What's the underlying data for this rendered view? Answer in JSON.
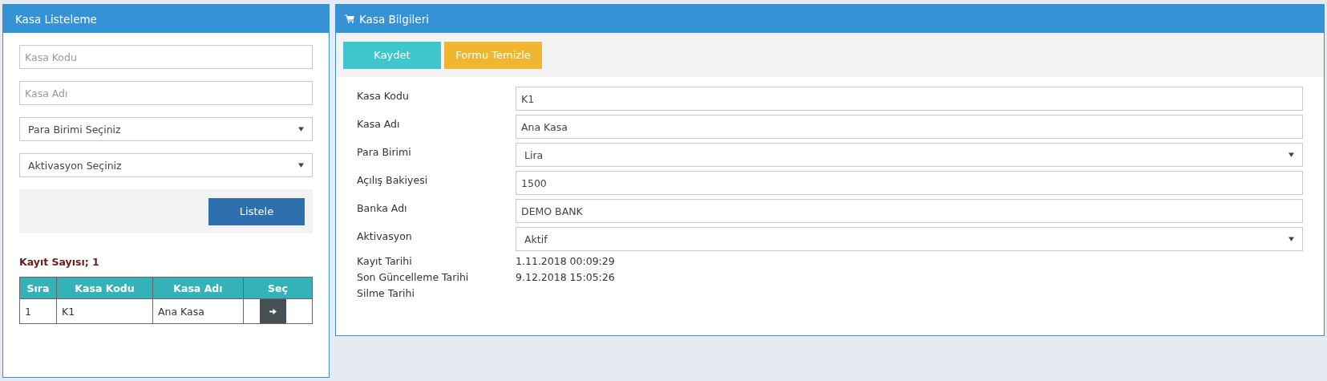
{
  "list_panel": {
    "title": "Kasa Listeleme",
    "filters": [
      {
        "kind": "text",
        "placeholder": "Kasa Kodu"
      },
      {
        "kind": "text",
        "placeholder": "Kasa Adı"
      },
      {
        "kind": "select",
        "value": "Para Birimi Seçiniz"
      },
      {
        "kind": "select",
        "value": "Aktivasyon Seçiniz"
      }
    ],
    "list_button": "Listele",
    "record_count": "Kayıt Sayısı; 1",
    "table": {
      "columns": [
        "Sıra",
        "Kasa Kodu",
        "Kasa Adı",
        "Seç"
      ],
      "rows": [
        {
          "cells": [
            "1",
            "K1",
            "Ana Kasa"
          ]
        }
      ]
    }
  },
  "detail_panel": {
    "title": "Kasa Bilgileri",
    "buttons": [
      {
        "kind": "save",
        "label": "Kaydet"
      },
      {
        "kind": "clear",
        "label": "Formu Temizle"
      }
    ],
    "fields": [
      {
        "kind": "text",
        "label": "Kasa Kodu",
        "value": "K1"
      },
      {
        "kind": "text",
        "label": "Kasa Adı",
        "value": "Ana Kasa"
      },
      {
        "kind": "select",
        "label": "Para Birimi",
        "value": "Lira"
      },
      {
        "kind": "text",
        "label": "Açılış Bakiyesi",
        "value": "1500"
      },
      {
        "kind": "text",
        "label": "Banka Adı",
        "value": "DEMO BANK"
      },
      {
        "kind": "select",
        "label": "Aktivasyon",
        "value": "Aktif"
      },
      {
        "kind": "static",
        "label": "Kayıt Tarihi",
        "value": "1.11.2018 00:09:29"
      },
      {
        "kind": "static",
        "label": "Son Güncelleme Tarihi",
        "value": "9.12.2018 15:05:26"
      },
      {
        "kind": "static",
        "label": "Silme Tarihi"
      }
    ]
  }
}
